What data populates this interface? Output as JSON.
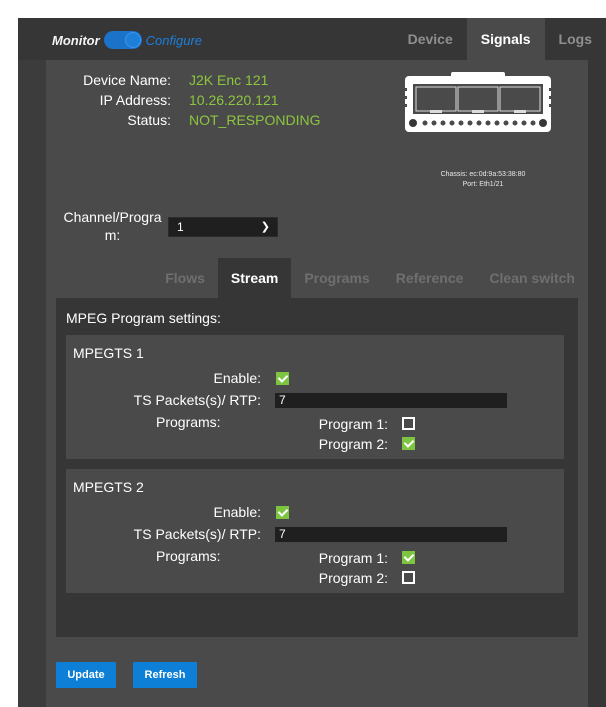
{
  "header": {
    "mode_left": "Monitor",
    "mode_right": "Configure",
    "tabs": [
      {
        "label": "Device",
        "active": false
      },
      {
        "label": "Signals",
        "active": true
      },
      {
        "label": "Logs",
        "active": false
      }
    ]
  },
  "device": {
    "name_label": "Device Name:",
    "name_value": "J2K Enc 121",
    "ip_label": "IP Address:",
    "ip_value": "10.26.220.121",
    "status_label": "Status:",
    "status_value": "NOT_RESPONDING",
    "chassis": "Chassis: ec:0d:9a:53:38:80",
    "port": "Port: Eth1/21"
  },
  "channel": {
    "label": "Channel/Program:",
    "label_line1": "Channel/Progra",
    "label_line2": "m:",
    "selected": "1"
  },
  "subtabs": [
    {
      "label": "Flows",
      "active": false
    },
    {
      "label": "Stream",
      "active": true
    },
    {
      "label": "Programs",
      "active": false
    },
    {
      "label": "Reference",
      "active": false
    },
    {
      "label": "Clean switch",
      "active": false
    }
  ],
  "stream": {
    "title": "MPEG Program settings:",
    "enable_label": "Enable:",
    "ts_label": "TS Packets(s)/ RTP:",
    "programs_label": "Programs:",
    "program1_label": "Program 1:",
    "program2_label": "Program 2:",
    "groups": [
      {
        "title": "MPEGTS 1",
        "enabled": true,
        "ts_packets": "7",
        "program1": false,
        "program2": true
      },
      {
        "title": "MPEGTS 2",
        "enabled": true,
        "ts_packets": "7",
        "program1": true,
        "program2": false
      }
    ]
  },
  "buttons": {
    "update": "Update",
    "refresh": "Refresh"
  },
  "colors": {
    "accent": "#0d7fd6",
    "value_green": "#8cc63f",
    "checkbox_green": "#7dc540"
  }
}
